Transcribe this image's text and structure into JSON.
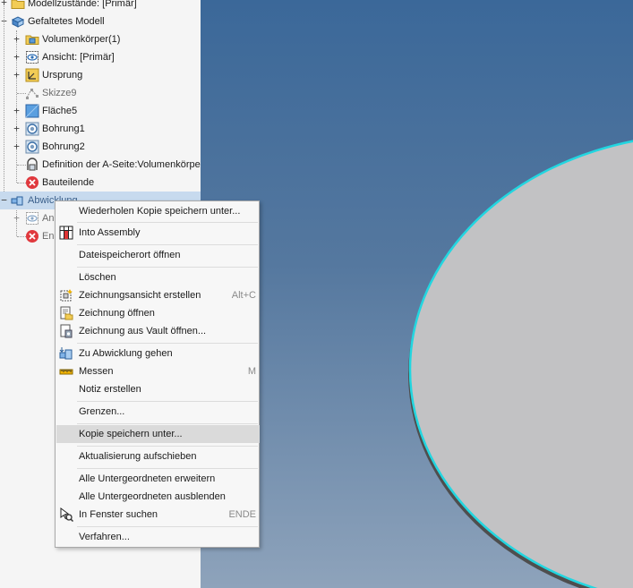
{
  "browser": {
    "items": [
      {
        "label": "Modellzustände: [Primär]",
        "icon": "folder-icon"
      },
      {
        "label": "Gefaltetes Modell",
        "icon": "sheet-metal-icon"
      },
      {
        "label": "Volumenkörper(1)",
        "icon": "solid-bodies-folder-icon"
      },
      {
        "label": "Ansicht: [Primär]",
        "icon": "view-icon"
      },
      {
        "label": "Ursprung",
        "icon": "origin-icon"
      },
      {
        "label": "Skizze9",
        "icon": "sketch-icon"
      },
      {
        "label": "Fläche5",
        "icon": "face-icon"
      },
      {
        "label": "Bohrung1",
        "icon": "hole-icon"
      },
      {
        "label": "Bohrung2",
        "icon": "hole-icon"
      },
      {
        "label": "Definition der A-Seite:Volumenkörper",
        "icon": "a-side-definition-icon"
      },
      {
        "label": "Bauteilende",
        "icon": "end-of-part-icon"
      },
      {
        "label": "Abwicklung",
        "icon": "flat-pattern-icon"
      },
      {
        "label": "An",
        "icon": "view-icon"
      },
      {
        "label": "En",
        "icon": "end-of-part-icon"
      }
    ]
  },
  "context_menu": {
    "items": [
      {
        "label": "Wiederholen Kopie speichern unter...",
        "shortcut": ""
      },
      {
        "label": "Into Assembly",
        "shortcut": "",
        "icon": "into-assembly-icon"
      },
      {
        "label": "Dateispeicherort öffnen",
        "shortcut": ""
      },
      {
        "label": "Löschen",
        "shortcut": ""
      },
      {
        "label": "Zeichnungsansicht erstellen",
        "shortcut": "Alt+C",
        "icon": "create-drawing-view-icon"
      },
      {
        "label": "Zeichnung öffnen",
        "shortcut": "",
        "icon": "open-drawing-icon"
      },
      {
        "label": "Zeichnung aus Vault öffnen...",
        "shortcut": "",
        "icon": "vault-drawing-icon"
      },
      {
        "label": "Zu Abwicklung gehen",
        "shortcut": "",
        "icon": "go-to-flat-pattern-icon"
      },
      {
        "label": "Messen",
        "shortcut": "M",
        "icon": "measure-icon"
      },
      {
        "label": "Notiz erstellen",
        "shortcut": ""
      },
      {
        "label": "Grenzen...",
        "shortcut": ""
      },
      {
        "label": "Kopie speichern unter...",
        "shortcut": ""
      },
      {
        "label": "Aktualisierung aufschieben",
        "shortcut": ""
      },
      {
        "label": "Alle Untergeordneten erweitern",
        "shortcut": ""
      },
      {
        "label": "Alle Untergeordneten ausblenden",
        "shortcut": ""
      },
      {
        "label": "In Fenster suchen",
        "shortcut": "ENDE",
        "icon": "find-in-window-icon"
      },
      {
        "label": "Verfahren...",
        "shortcut": ""
      }
    ]
  },
  "colors": {
    "viewport_top": "#3b6899",
    "viewport_bottom": "#8ea3bb",
    "part_fill": "#c2c2c4",
    "part_edge": "#22d6e0",
    "selection": "#c7daee",
    "menu_hover": "#dadada"
  }
}
